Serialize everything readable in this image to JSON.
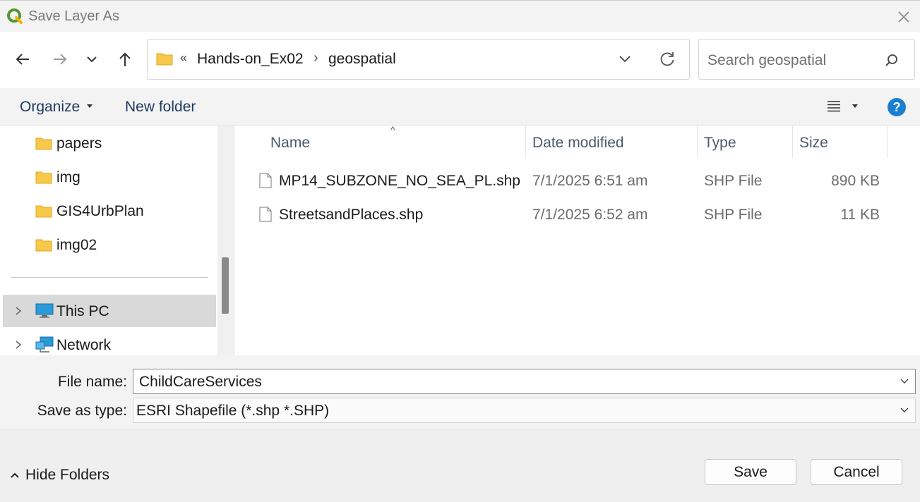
{
  "window": {
    "title": "Save Layer As"
  },
  "address": {
    "overflow": "«",
    "crumbs": [
      "Hands-on_Ex02",
      "geospatial"
    ]
  },
  "search": {
    "placeholder": "Search geospatial"
  },
  "toolbar": {
    "organize_label": "Organize",
    "new_folder_label": "New folder",
    "help_label": "?"
  },
  "sidebar": {
    "items": [
      {
        "label": "papers"
      },
      {
        "label": "img"
      },
      {
        "label": "GIS4UrbPlan"
      },
      {
        "label": "img02"
      },
      {
        "label": "This PC"
      },
      {
        "label": "Network"
      }
    ]
  },
  "files": {
    "columns": [
      "Name",
      "Date modified",
      "Type",
      "Size"
    ],
    "sort_indicator": "^",
    "rows": [
      {
        "name": "MP14_SUBZONE_NO_SEA_PL.shp",
        "date": "7/1/2025 6:51 am",
        "type": "SHP File",
        "size": "890 KB"
      },
      {
        "name": "StreetsandPlaces.shp",
        "date": "7/1/2025 6:52 am",
        "type": "SHP File",
        "size": "11 KB"
      }
    ]
  },
  "form": {
    "file_name_label": "File name:",
    "file_name_value": "ChildCareServices",
    "save_type_label": "Save as type:",
    "save_type_value": "ESRI Shapefile (*.shp *.SHP)"
  },
  "footer": {
    "hide_folders_label": "Hide Folders",
    "save_label": "Save",
    "cancel_label": "Cancel"
  },
  "colors": {
    "accent": "#1a7fd1",
    "folder": "#f8c84a",
    "qgis_green": "#589632"
  }
}
